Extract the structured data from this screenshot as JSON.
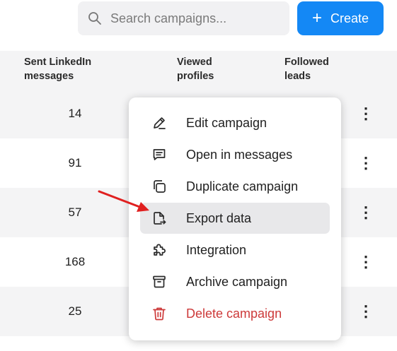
{
  "search": {
    "placeholder": "Search campaigns..."
  },
  "create_button": {
    "label": "Create"
  },
  "columns": [
    "Sent LinkedIn messages",
    "Viewed profiles",
    "Followed leads"
  ],
  "rows": [
    {
      "sent_messages": "14"
    },
    {
      "sent_messages": "91"
    },
    {
      "sent_messages": "57"
    },
    {
      "sent_messages": "168"
    },
    {
      "sent_messages": "25"
    }
  ],
  "menu": {
    "items": [
      {
        "label": "Edit campaign",
        "icon": "pencil-icon"
      },
      {
        "label": "Open in messages",
        "icon": "message-icon"
      },
      {
        "label": "Duplicate campaign",
        "icon": "copy-icon"
      },
      {
        "label": "Export data",
        "icon": "file-export-icon",
        "highlighted": true
      },
      {
        "label": "Integration",
        "icon": "puzzle-icon"
      },
      {
        "label": "Archive campaign",
        "icon": "archive-icon"
      },
      {
        "label": "Delete campaign",
        "icon": "trash-icon",
        "danger": true
      }
    ]
  },
  "colors": {
    "accent": "#1488f5",
    "danger": "#cd3a3a",
    "annotation_arrow": "#e02020",
    "highlight": "#e8e8ea"
  }
}
